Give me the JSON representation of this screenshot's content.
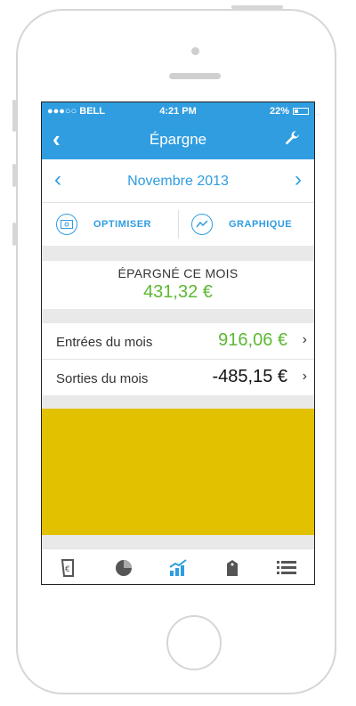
{
  "status_bar": {
    "carrier": "●●●○○ BELL",
    "time": "4:21 PM",
    "battery": "22%"
  },
  "nav": {
    "title": "Épargne",
    "back_icon": "chevron-left-icon",
    "settings_icon": "wrench-icon"
  },
  "month": {
    "label": "Novembre 2013",
    "prev_icon": "chevron-left-icon",
    "next_icon": "chevron-right-icon"
  },
  "actions": {
    "optimize_label": "OPTIMISER",
    "chart_label": "GRAPHIQUE"
  },
  "summary": {
    "label": "ÉPARGNÉ CE MOIS",
    "value": "431,32 €"
  },
  "rows": [
    {
      "label": "Entrées du mois",
      "value": "916,06 €",
      "color": "#5cb832"
    },
    {
      "label": "Sorties du mois",
      "value": "-485,15 €",
      "color": "#111111"
    }
  ],
  "chart_color": "#e2c100",
  "tabs": [
    {
      "icon": "document-euro-icon",
      "active": false
    },
    {
      "icon": "pie-chart-icon",
      "active": false
    },
    {
      "icon": "growth-chart-icon",
      "active": true
    },
    {
      "icon": "price-tag-icon",
      "active": false
    },
    {
      "icon": "list-icon",
      "active": false
    }
  ],
  "colors": {
    "accent": "#2f9de0",
    "positive": "#5cb832"
  }
}
